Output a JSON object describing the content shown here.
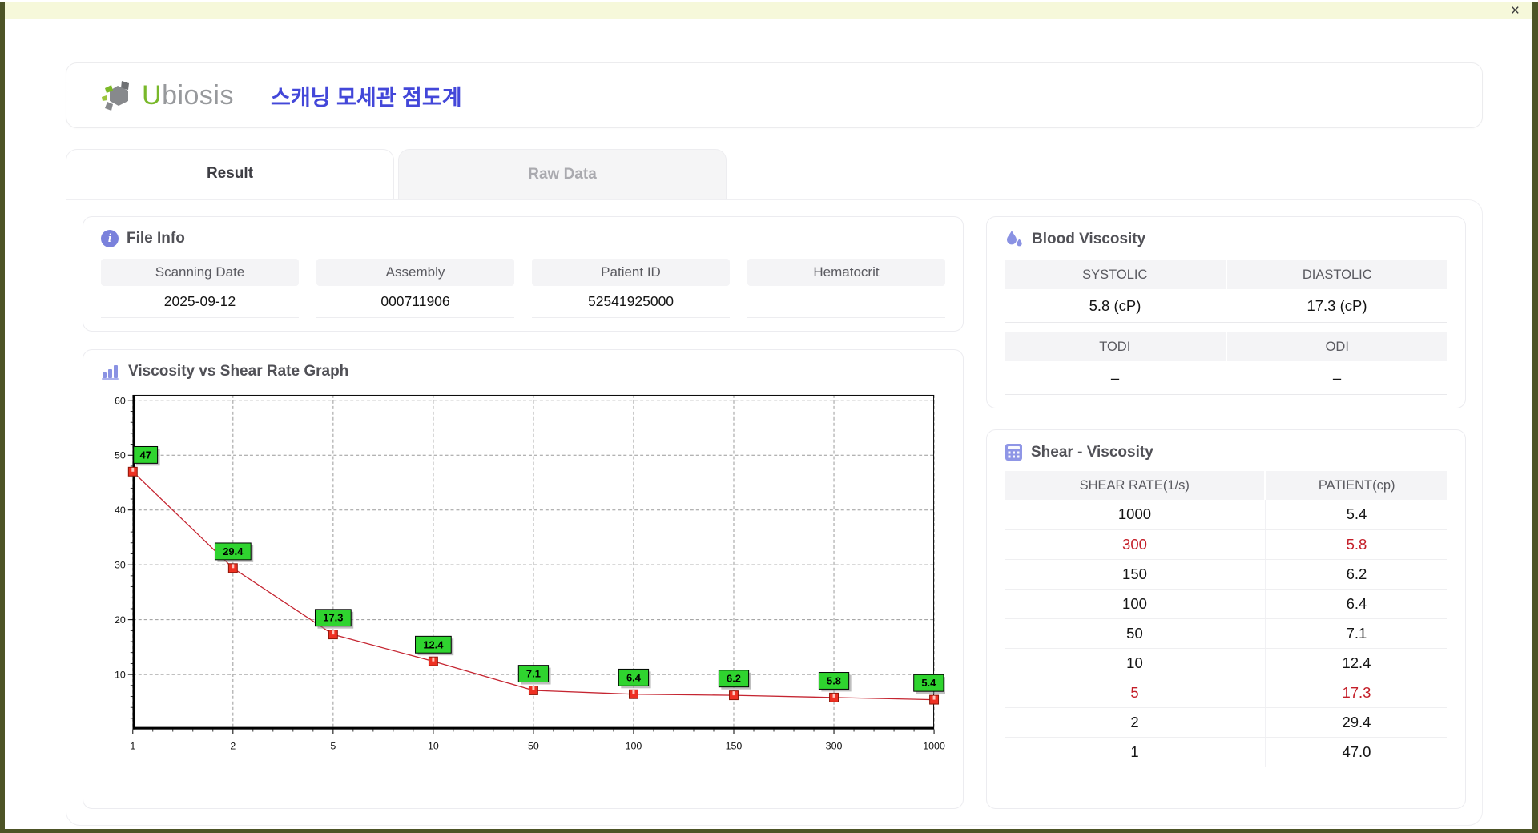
{
  "window": {
    "close_label": "×"
  },
  "header": {
    "brand_first": "U",
    "brand_rest": "biosis",
    "app_title": "스캐닝 모세관 점도계"
  },
  "tabs": [
    {
      "label": "Result",
      "active": true
    },
    {
      "label": "Raw Data",
      "active": false
    }
  ],
  "file_info": {
    "title": "File Info",
    "fields": [
      {
        "label": "Scanning Date",
        "value": "2025-09-12"
      },
      {
        "label": "Assembly",
        "value": "000711906"
      },
      {
        "label": "Patient ID",
        "value": "52541925000"
      },
      {
        "label": "Hematocrit",
        "value": ""
      }
    ]
  },
  "blood_viscosity": {
    "title": "Blood Viscosity",
    "sections": [
      {
        "cols": [
          {
            "label": "SYSTOLIC",
            "value": "5.8 (cP)"
          },
          {
            "label": "DIASTOLIC",
            "value": "17.3 (cP)"
          }
        ]
      },
      {
        "cols": [
          {
            "label": "TODI",
            "value": "–"
          },
          {
            "label": "ODI",
            "value": "–"
          }
        ]
      }
    ]
  },
  "shear_viscosity": {
    "title": "Shear - Viscosity",
    "columns": [
      "SHEAR RATE(1/s)",
      "PATIENT(cp)"
    ],
    "rows": [
      {
        "shear_rate": "1000",
        "patient": "5.4",
        "highlight": false
      },
      {
        "shear_rate": "300",
        "patient": "5.8",
        "highlight": true
      },
      {
        "shear_rate": "150",
        "patient": "6.2",
        "highlight": false
      },
      {
        "shear_rate": "100",
        "patient": "6.4",
        "highlight": false
      },
      {
        "shear_rate": "50",
        "patient": "7.1",
        "highlight": false
      },
      {
        "shear_rate": "10",
        "patient": "12.4",
        "highlight": false
      },
      {
        "shear_rate": "5",
        "patient": "17.3",
        "highlight": true
      },
      {
        "shear_rate": "2",
        "patient": "29.4",
        "highlight": false
      },
      {
        "shear_rate": "1",
        "patient": "47.0",
        "highlight": false
      }
    ]
  },
  "graph": {
    "title": "Viscosity vs Shear Rate Graph"
  },
  "chart_data": {
    "type": "line",
    "title": "Viscosity vs Shear Rate Graph",
    "x_categories": [
      "1",
      "2",
      "5",
      "10",
      "50",
      "100",
      "150",
      "300",
      "1000"
    ],
    "values": [
      47,
      29.4,
      17.3,
      12.4,
      7.1,
      6.4,
      6.2,
      5.8,
      5.4
    ],
    "point_labels": [
      "47",
      "29.4",
      "17.3",
      "12.4",
      "7.1",
      "6.4",
      "6.2",
      "5.8",
      "5.4"
    ],
    "y_ticks": [
      10,
      20,
      30,
      40,
      50,
      60
    ],
    "ylim": [
      0,
      61
    ],
    "grid": true,
    "legend": "none",
    "line_color": "#c52531",
    "marker_color": "#ee3123",
    "marker_border": "#8d1507",
    "label_bg": "#2fd42f"
  }
}
